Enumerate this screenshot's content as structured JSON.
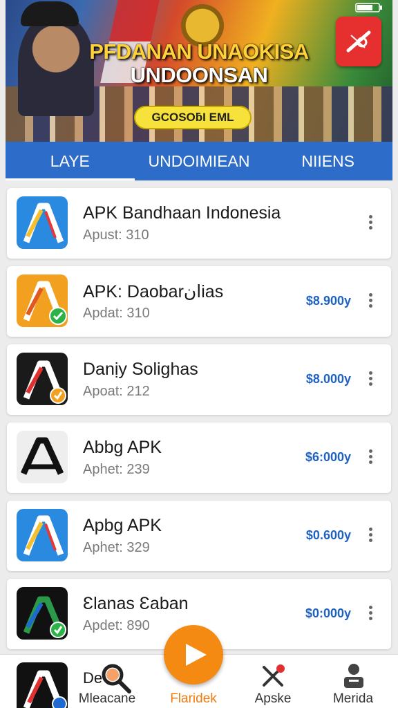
{
  "banner": {
    "title_line1": "PFDANAN UNAOKISA",
    "title_line2": "UNDOONSAN",
    "pill_text": "GCOSOƃI EML",
    "colors": {
      "pill": "#f6e23a",
      "badge": "#e63030"
    }
  },
  "tabs": [
    {
      "label": "LAYE",
      "active": true
    },
    {
      "label": "UNDOIMIEAN",
      "active": false
    },
    {
      "label": "NIIENS",
      "active": false
    }
  ],
  "apps": [
    {
      "name": "APK Bandhaan Indonesia",
      "meta": "Apust: 310",
      "price": "",
      "icon": "a-logo-blue-icon"
    },
    {
      "name": "APK: Daobarانias",
      "meta": "Apdat: 310",
      "price": "$8.900y",
      "icon": "a-logo-orange-icon"
    },
    {
      "name": "Danịy Solighas",
      "meta": "Apoat: 212",
      "price": "$8.000y",
      "icon": "a-logo-dark-icon"
    },
    {
      "name": "Abbg APK",
      "meta": "Aphet: 239",
      "price": "$6:000y",
      "icon": "a-logo-gray-icon"
    },
    {
      "name": "Apbg APK",
      "meta": "Aphet: 329",
      "price": "$0.600y",
      "icon": "a-logo-blue-icon"
    },
    {
      "name": "Ɛlanas Ɛaban",
      "meta": "Apdet: 890",
      "price": "$0:000y",
      "icon": "a-logo-green-icon"
    }
  ],
  "peek": {
    "text": "De"
  },
  "nav": [
    {
      "label": "Mleacane",
      "icon": "search-icon",
      "active": false
    },
    {
      "label": "Flaridek",
      "icon": "play-icon",
      "active": true
    },
    {
      "label": "Apske",
      "icon": "tools-icon",
      "active": false
    },
    {
      "label": "Merida",
      "icon": "person-icon",
      "active": false
    }
  ],
  "colors": {
    "accent": "#2e6cc9",
    "price": "#1f62c2",
    "fab": "#f48a12"
  }
}
